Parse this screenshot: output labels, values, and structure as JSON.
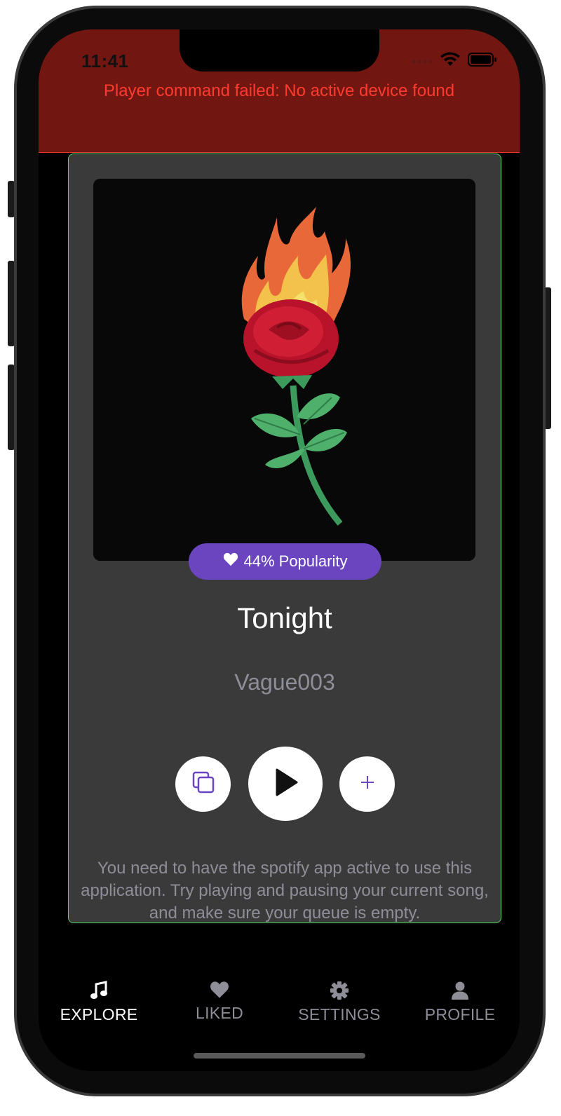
{
  "status_bar": {
    "time": "11:41"
  },
  "banner": {
    "error": "Player command failed: No active device found"
  },
  "track": {
    "popularity_label": "44% Popularity",
    "popularity": 44,
    "title": "Tonight",
    "artist": "Vague003"
  },
  "controls": {
    "queue_icon": "copy-icon",
    "play_icon": "play-icon",
    "add_icon": "plus-icon"
  },
  "info_text": "You need to have the spotify app active to use this application. Try playing and pausing your current song, and make sure your queue is empty.",
  "tabs": [
    {
      "label": "EXPLORE",
      "icon": "music-note-icon",
      "active": true
    },
    {
      "label": "LIKED",
      "icon": "heart-icon",
      "active": false
    },
    {
      "label": "SETTINGS",
      "icon": "gear-icon",
      "active": false
    },
    {
      "label": "PROFILE",
      "icon": "person-icon",
      "active": false
    }
  ],
  "colors": {
    "banner": "#711610",
    "error_text": "#ff3b30",
    "accent": "#6b45c0",
    "card": "#3a3a3a",
    "card_border": "#4cd964",
    "tab_active": "#ffffff",
    "tab_inactive": "#8e8e99"
  }
}
